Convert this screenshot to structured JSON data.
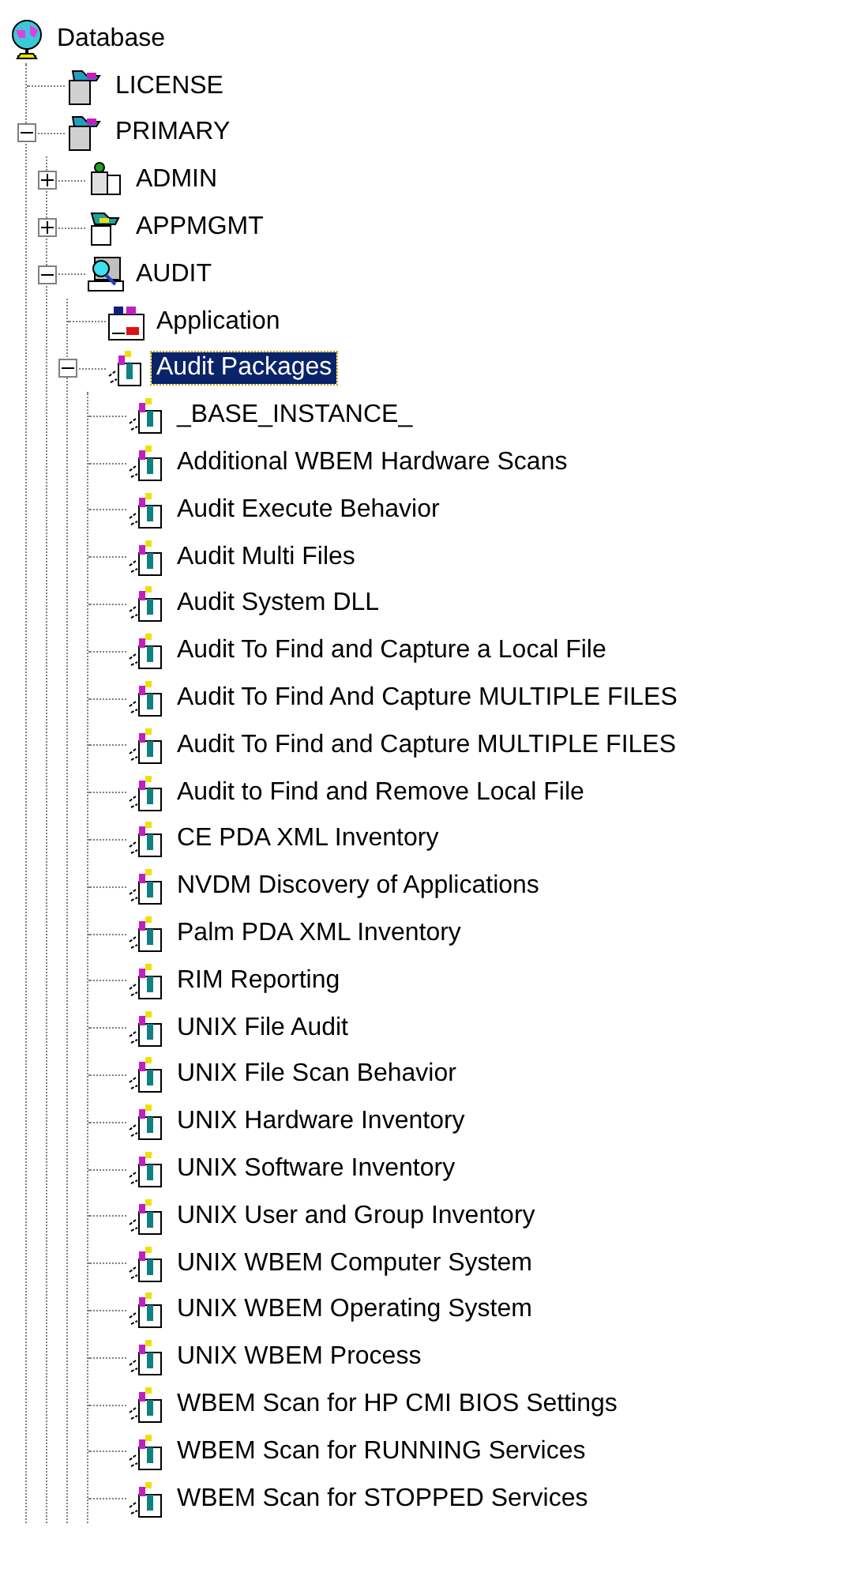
{
  "tree": [
    {
      "label": "Database",
      "kind": "globe",
      "selected": false,
      "children": [
        {
          "label": "LICENSE",
          "kind": "package",
          "selected": false
        },
        {
          "label": "PRIMARY",
          "kind": "package",
          "selected": false,
          "expanded": true,
          "children": [
            {
              "label": "ADMIN",
              "kind": "admin",
              "selected": false,
              "expanded": false
            },
            {
              "label": "APPMGMT",
              "kind": "appmgmt",
              "selected": false,
              "expanded": false
            },
            {
              "label": "AUDIT",
              "kind": "audit",
              "selected": false,
              "expanded": true,
              "children": [
                {
                  "label": "Application",
                  "kind": "application",
                  "selected": false
                },
                {
                  "label": "Audit Packages",
                  "kind": "audit-package",
                  "selected": true,
                  "expanded": true,
                  "children": [
                    {
                      "label": "_BASE_INSTANCE_",
                      "kind": "audit-package",
                      "selected": false
                    },
                    {
                      "label": "Additional WBEM Hardware Scans",
                      "kind": "audit-package",
                      "selected": false
                    },
                    {
                      "label": "Audit Execute Behavior",
                      "kind": "audit-package",
                      "selected": false
                    },
                    {
                      "label": "Audit Multi Files",
                      "kind": "audit-package",
                      "selected": false
                    },
                    {
                      "label": "Audit System DLL",
                      "kind": "audit-package",
                      "selected": false
                    },
                    {
                      "label": "Audit To Find and Capture a Local File",
                      "kind": "audit-package",
                      "selected": false
                    },
                    {
                      "label": "Audit To Find And Capture MULTIPLE FILES",
                      "kind": "audit-package",
                      "selected": false
                    },
                    {
                      "label": "Audit To Find and Capture MULTIPLE FILES",
                      "kind": "audit-package",
                      "selected": false
                    },
                    {
                      "label": "Audit to Find and Remove Local File",
                      "kind": "audit-package",
                      "selected": false
                    },
                    {
                      "label": "CE PDA XML Inventory",
                      "kind": "audit-package",
                      "selected": false
                    },
                    {
                      "label": "NVDM Discovery of Applications",
                      "kind": "audit-package",
                      "selected": false
                    },
                    {
                      "label": "Palm PDA XML Inventory",
                      "kind": "audit-package",
                      "selected": false
                    },
                    {
                      "label": "RIM Reporting",
                      "kind": "audit-package",
                      "selected": false
                    },
                    {
                      "label": "UNIX File Audit",
                      "kind": "audit-package",
                      "selected": false
                    },
                    {
                      "label": "UNIX File Scan Behavior",
                      "kind": "audit-package",
                      "selected": false
                    },
                    {
                      "label": "UNIX Hardware Inventory",
                      "kind": "audit-package",
                      "selected": false
                    },
                    {
                      "label": "UNIX Software Inventory",
                      "kind": "audit-package",
                      "selected": false
                    },
                    {
                      "label": "UNIX User and Group Inventory",
                      "kind": "audit-package",
                      "selected": false
                    },
                    {
                      "label": "UNIX WBEM Computer System",
                      "kind": "audit-package",
                      "selected": false
                    },
                    {
                      "label": "UNIX WBEM Operating System",
                      "kind": "audit-package",
                      "selected": false
                    },
                    {
                      "label": "UNIX WBEM Process",
                      "kind": "audit-package",
                      "selected": false
                    },
                    {
                      "label": "WBEM Scan for HP CMI BIOS Settings",
                      "kind": "audit-package",
                      "selected": false
                    },
                    {
                      "label": "WBEM Scan for RUNNING Services",
                      "kind": "audit-package",
                      "selected": false
                    },
                    {
                      "label": "WBEM Scan for STOPPED Services",
                      "kind": "audit-package",
                      "selected": false
                    }
                  ]
                }
              ]
            }
          ]
        }
      ]
    }
  ]
}
